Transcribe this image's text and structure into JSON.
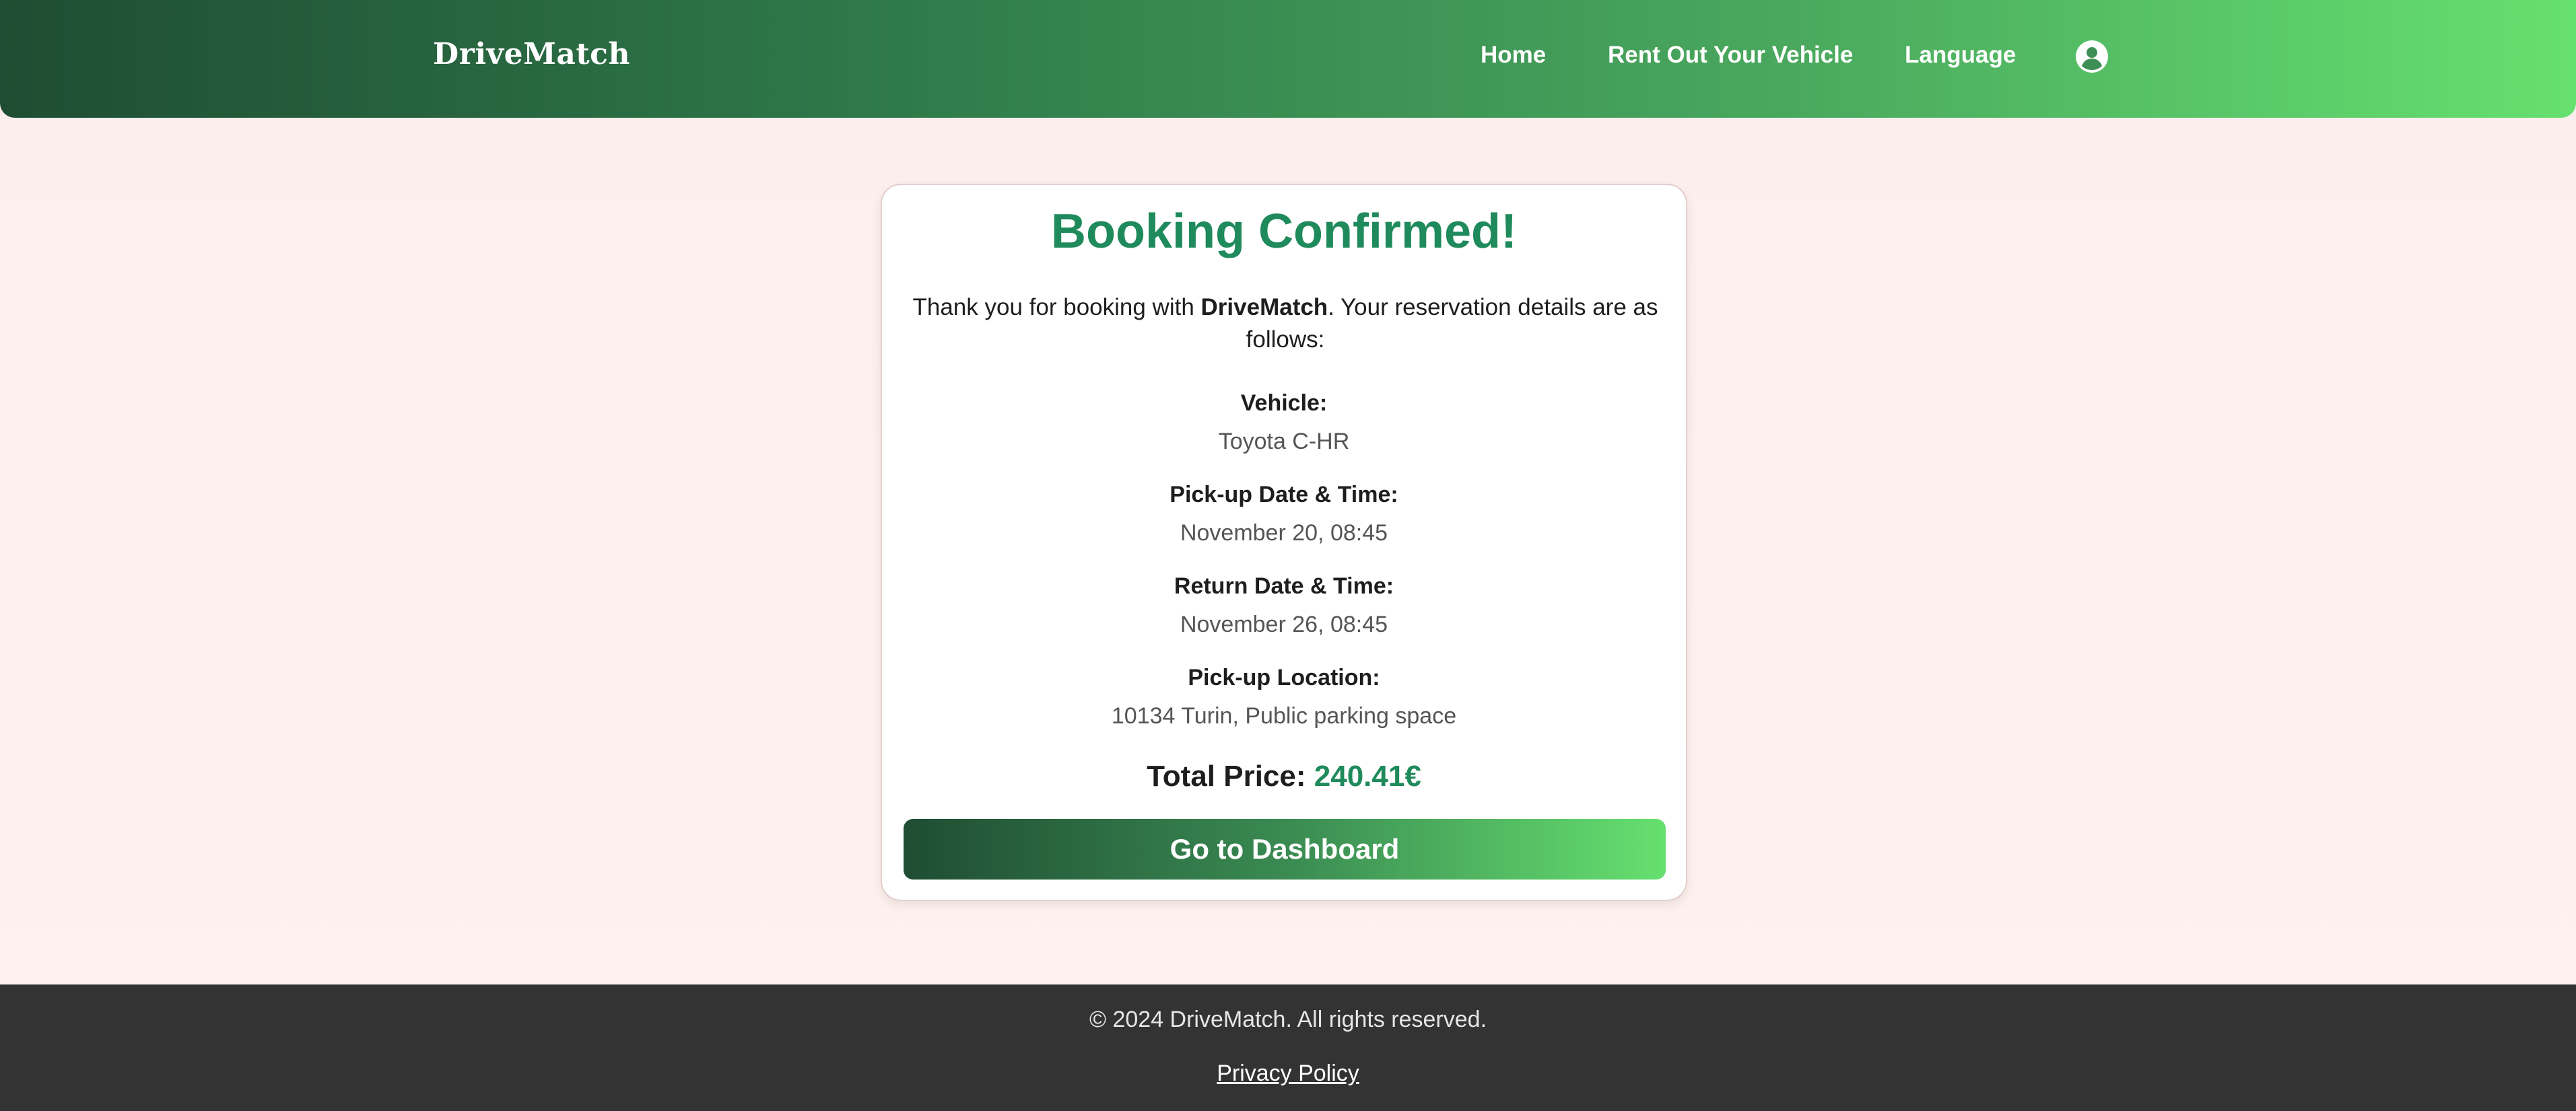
{
  "nav": {
    "brand": "DriveMatch",
    "links": [
      "Home",
      "Rent Out Your Vehicle",
      "Language"
    ],
    "user_icon": "user-circle-icon"
  },
  "confirmation": {
    "title": "Booking Confirmed!",
    "intro_prefix": "Thank you for booking with ",
    "intro_brand": "DriveMatch",
    "intro_suffix": ". Your reservation details are as follows:",
    "details": [
      {
        "label": "Vehicle:",
        "value": "Toyota C-HR"
      },
      {
        "label": "Pick-up Date & Time:",
        "value": "November 20, 08:45"
      },
      {
        "label": "Return Date & Time:",
        "value": "November 26, 08:45"
      },
      {
        "label": "Pick-up Location:",
        "value": "10134 Turin, Public parking space"
      }
    ],
    "total_label": "Total Price:",
    "total_value": "240.41€",
    "button_label": "Go to Dashboard"
  },
  "footer": {
    "copyright": "© 2024 DriveMatch. All rights reserved.",
    "privacy": "Privacy Policy"
  },
  "colors": {
    "accent_green": "#1f8a5b",
    "gradient_dark": "#1f4d33",
    "gradient_light": "#66e06f",
    "footer_bg": "#333333"
  }
}
